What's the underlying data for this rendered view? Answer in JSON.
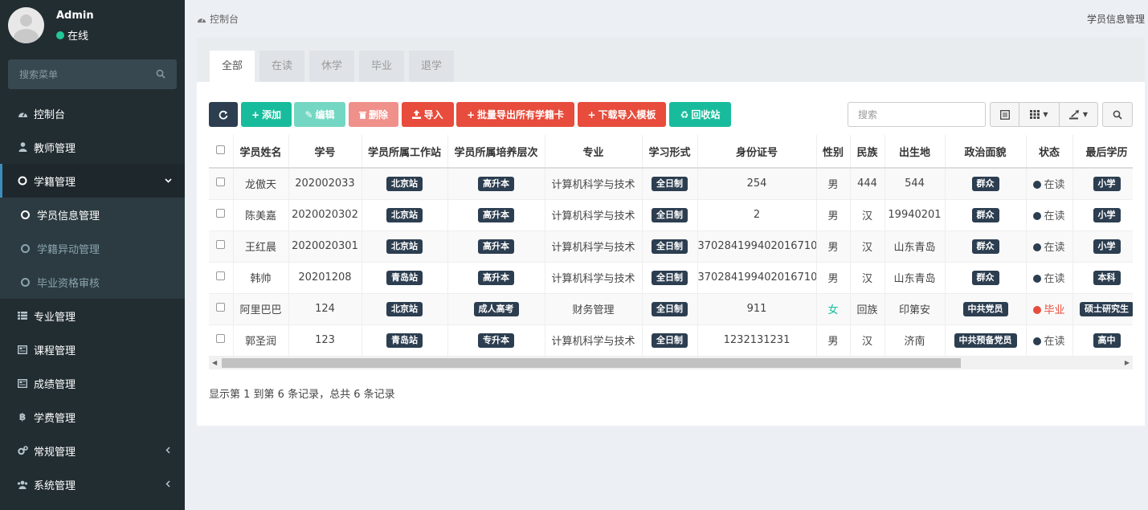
{
  "user": {
    "name": "Admin",
    "status": "在线"
  },
  "sidebar": {
    "search_placeholder": "搜索菜单",
    "items": [
      {
        "label": "控制台",
        "icon": "dashboard-icon"
      },
      {
        "label": "教师管理",
        "icon": "user-icon"
      },
      {
        "label": "学籍管理",
        "icon": "circle-icon",
        "expanded": true,
        "children": [
          {
            "label": "学员信息管理",
            "active": true
          },
          {
            "label": "学籍异动管理"
          },
          {
            "label": "毕业资格审核"
          }
        ]
      },
      {
        "label": "专业管理",
        "icon": "list-icon"
      },
      {
        "label": "课程管理",
        "icon": "newspaper-icon"
      },
      {
        "label": "成绩管理",
        "icon": "newspaper-icon"
      },
      {
        "label": "学费管理",
        "icon": "bitcoin-icon"
      },
      {
        "label": "常规管理",
        "icon": "cogs-icon"
      },
      {
        "label": "系统管理",
        "icon": "users-icon"
      }
    ]
  },
  "breadcrumb": {
    "home": "控制台",
    "page": "学员信息管理"
  },
  "tabs": [
    "全部",
    "在读",
    "休学",
    "毕业",
    "退学"
  ],
  "toolbar": {
    "refresh": "",
    "add": "添加",
    "edit": "编辑",
    "delete": "删除",
    "import": "导入",
    "export_cards": "批量导出所有学籍卡",
    "download_template": "下载导入模板",
    "recycle": "回收站"
  },
  "search": {
    "placeholder": "搜索"
  },
  "table": {
    "columns": [
      "学员姓名",
      "学号",
      "学员所属工作站",
      "学员所属培养层次",
      "专业",
      "学习形式",
      "身份证号",
      "性别",
      "民族",
      "出生地",
      "政治面貌",
      "状态",
      "最后学历"
    ],
    "rows": [
      {
        "name": "龙傲天",
        "id": "202002033",
        "station": "北京站",
        "level": "高升本",
        "major": "计算机科学与技术",
        "form": "全日制",
        "idcard": "254",
        "gender": "男",
        "ethnic": "444",
        "birthplace": "544",
        "politics": "群众",
        "status": "在读",
        "edu": "小学"
      },
      {
        "name": "陈美嘉",
        "id": "2020020302",
        "station": "北京站",
        "level": "高升本",
        "major": "计算机科学与技术",
        "form": "全日制",
        "idcard": "2",
        "gender": "男",
        "ethnic": "汉",
        "birthplace": "19940201",
        "politics": "群众",
        "status": "在读",
        "edu": "小学"
      },
      {
        "name": "王红晨",
        "id": "2020020301",
        "station": "北京站",
        "level": "高升本",
        "major": "计算机科学与技术",
        "form": "全日制",
        "idcard": "370284199402016710",
        "gender": "男",
        "ethnic": "汉",
        "birthplace": "山东青岛",
        "politics": "群众",
        "status": "在读",
        "edu": "小学"
      },
      {
        "name": "韩帅",
        "id": "20201208",
        "station": "青岛站",
        "level": "高升本",
        "major": "计算机科学与技术",
        "form": "全日制",
        "idcard": "370284199402016710",
        "gender": "男",
        "ethnic": "汉",
        "birthplace": "山东青岛",
        "politics": "群众",
        "status": "在读",
        "edu": "本科"
      },
      {
        "name": "阿里巴巴",
        "id": "124",
        "station": "北京站",
        "level": "成人高考",
        "major": "财务管理",
        "form": "全日制",
        "idcard": "911",
        "gender": "女",
        "ethnic": "回族",
        "birthplace": "印第安",
        "politics": "中共党员",
        "status": "毕业",
        "edu": "硕士研究生"
      },
      {
        "name": "郭圣润",
        "id": "123",
        "station": "青岛站",
        "level": "专升本",
        "major": "计算机科学与技术",
        "form": "全日制",
        "idcard": "1232131231",
        "gender": "男",
        "ethnic": "汉",
        "birthplace": "济南",
        "politics": "中共预备党员",
        "status": "在读",
        "edu": "高中"
      }
    ]
  },
  "pager": {
    "info": "显示第 1 到第 6 条记录，总共 6 条记录"
  },
  "colors": {
    "sidebar": "#222d32",
    "dark": "#2c3e50",
    "green": "#18bc9c",
    "red": "#e74c3c"
  }
}
